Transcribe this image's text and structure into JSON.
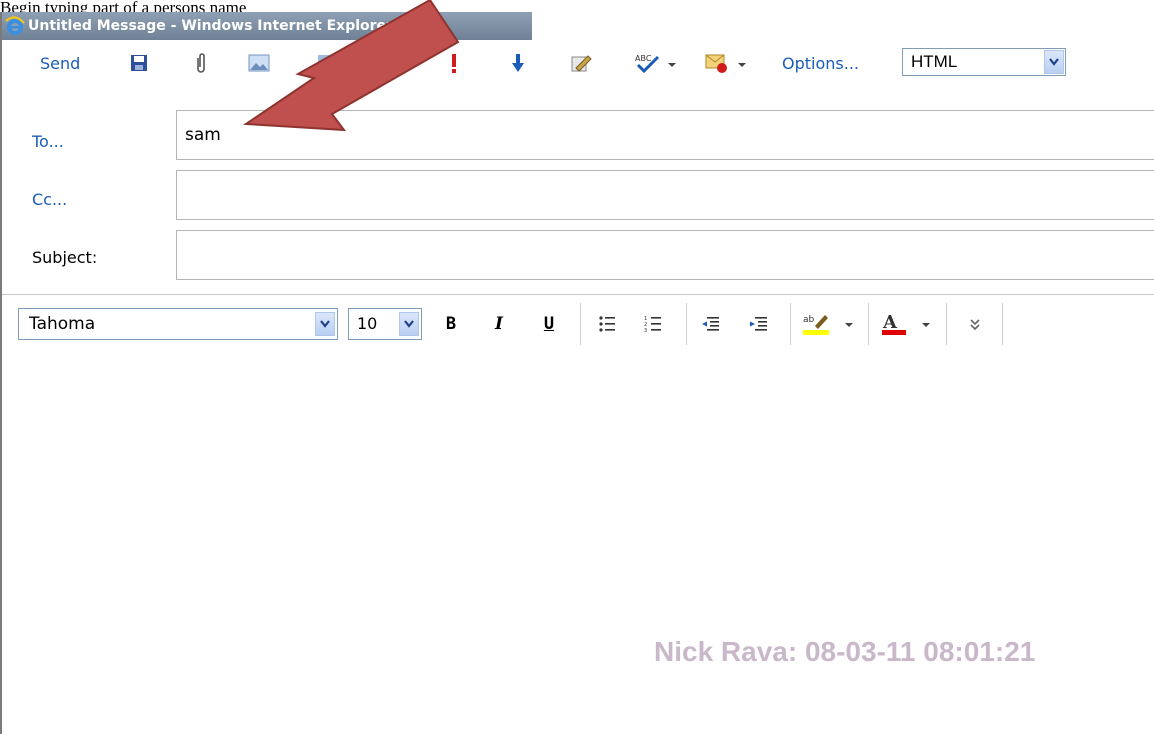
{
  "doc_caption": "Begin typing part of a persons name",
  "window": {
    "title": "Untitled Message - Windows Internet Explorer"
  },
  "toolbar": {
    "send_label": "Send",
    "options_label": "Options...",
    "format_value": "HTML",
    "icons": [
      "save-icon",
      "attach-icon",
      "insert-image-icon",
      "address-book-icon",
      "high-importance-icon",
      "low-importance-icon",
      "edit-icon",
      "spell-check-icon",
      "flag-icon"
    ]
  },
  "fields": {
    "to_label": "To...",
    "to_value": "sam",
    "cc_label": "Cc...",
    "cc_value": "",
    "subject_label": "Subject:",
    "subject_value": ""
  },
  "format": {
    "font_name": "Tahoma",
    "font_size": "10",
    "bold_label": "B",
    "italic_label": "I",
    "underline_label": "U"
  },
  "colors": {
    "link_blue": "#1a5cb8",
    "arrow_red": "#c0504d",
    "highlight_yellow": "#ffff00",
    "font_red": "#e00000",
    "watermark": "#c9b8c9"
  },
  "watermark": "Nick Rava: 08-03-11 08:01:21"
}
